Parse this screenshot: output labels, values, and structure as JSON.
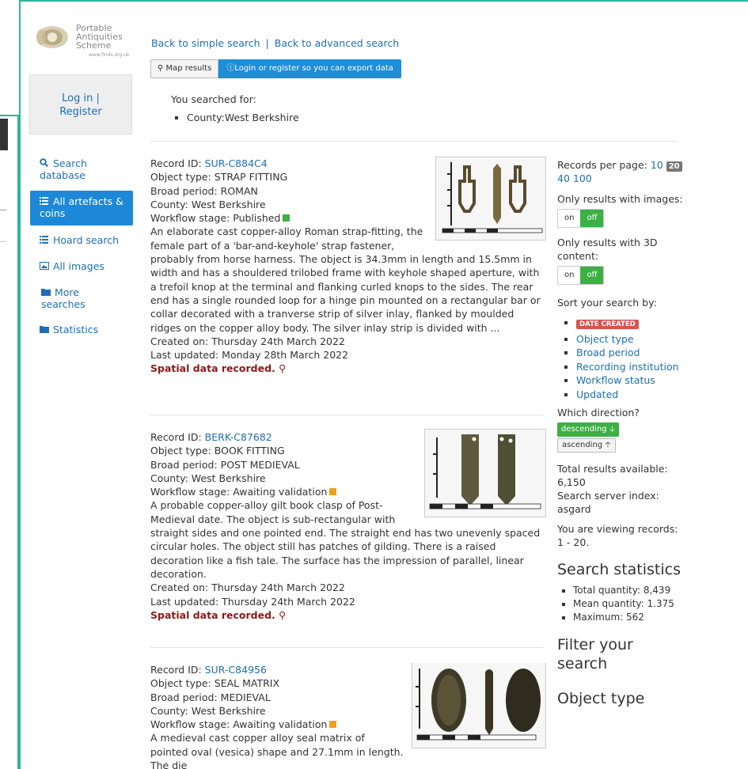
{
  "logo": {
    "line1": "Portable",
    "line2": "Antiquities",
    "line3": "Scheme",
    "url": "www.finds.org.uk"
  },
  "login": {
    "login": "Log in",
    "sep": "|",
    "register": "Register"
  },
  "nav": [
    {
      "label": "Search database",
      "icon": "search-icon"
    },
    {
      "label": "All artefacts & coins",
      "icon": "list-icon"
    },
    {
      "label": "Hoard search",
      "icon": "list-icon"
    },
    {
      "label": "All images",
      "icon": "image-icon"
    },
    {
      "label": "More searches",
      "icon": "folder-icon"
    },
    {
      "label": "Statistics",
      "icon": "folder-icon"
    }
  ],
  "crumbs": {
    "simple": "Back to simple search",
    "sep": "|",
    "advanced": "Back to advanced search"
  },
  "buttons": {
    "map": "Map results",
    "export": "Login or register so you can export data"
  },
  "searched": {
    "title": "You searched for:",
    "term": "County:West Berkshire"
  },
  "records": [
    {
      "id_label": "Record ID:",
      "id": "SUR-C884C4",
      "type": "Object type: STRAP FITTING",
      "period": "Broad period: ROMAN",
      "county": "County: West Berkshire",
      "workflow": "Workflow stage: Published",
      "desc": "An elaborate cast copper-alloy Roman strap-fitting, the female part of a 'bar-and-keyhole' strap fastener, probably from horse harness. The object is 34.3mm in length and 15.5mm in width and has a shouldered trilobed frame with keyhole shaped aperture, with a trefoil knop at the terminal and flanking curled knops to the sides. The rear end has a single rounded loop for a hinge pin mounted on a rectangular bar or collar decorated with a tranverse strip of silver inlay, flanked by moulded ridges on the copper alloy body. The silver inlay strip is divided with ...",
      "created": "Created on: Thursday 24th March 2022",
      "updated": "Last updated: Monday 28th March 2022",
      "spatial": "Spatial data recorded."
    },
    {
      "id_label": "Record ID:",
      "id": "BERK-C87682",
      "type": "Object type: BOOK FITTING",
      "period": "Broad period: POST MEDIEVAL",
      "county": "County: West Berkshire",
      "workflow": "Workflow stage: Awaiting validation",
      "desc": "A probable copper-alloy gilt book clasp of Post-Medieval date. The object is sub-rectangular with straight sides and one pointed end. The straight end has two unevenly spaced circular holes. The object still has patches of gilding. There is a raised decoration like a fish tale. The surface has the impression of parallel, linear decoration.",
      "created": "Created on: Thursday 24th March 2022",
      "updated": "Last updated: Thursday 24th March 2022",
      "spatial": "Spatial data recorded."
    },
    {
      "id_label": "Record ID:",
      "id": "SUR-C84956",
      "type": "Object type: SEAL MATRIX",
      "period": "Broad period: MEDIEVAL",
      "county": "County: West Berkshire",
      "workflow": "Workflow stage: Awaiting validation",
      "desc": "A medieval cast copper alloy seal matrix of pointed oval (vesica) shape and 27.1mm in length. The die",
      "created": "",
      "updated": "",
      "spatial": ""
    }
  ],
  "right": {
    "per_page_label": "Records per page:",
    "per_page": [
      "10",
      "20",
      "40",
      "100"
    ],
    "only_images": "Only results with images:",
    "only_3d": "Only results with 3D content:",
    "on": "on",
    "off": "off",
    "sort_label": "Sort your search by:",
    "sort": [
      "DATE CREATED",
      "Object type",
      "Broad period",
      "Recording institution",
      "Workflow status",
      "Updated"
    ],
    "direction_label": "Which direction?",
    "desc": "descending",
    "asc": "ascending",
    "total_label": "Total results available:",
    "total": "6,150",
    "index_label": "Search server index:",
    "index": "asgard",
    "viewing_label": "You are viewing records:",
    "viewing": "1 - 20.",
    "stats_title": "Search statistics",
    "stats": [
      "Total quantity: 8,439",
      "Mean quantity: 1.375",
      "Maximum: 562"
    ],
    "filter_title": "Filter your search",
    "object_type_title": "Object type"
  },
  "colors": {
    "accent": "#2bb5a0",
    "link": "#1f6fb2",
    "active": "#1e88d8",
    "green": "#3cb043",
    "red": "#d9534f"
  }
}
